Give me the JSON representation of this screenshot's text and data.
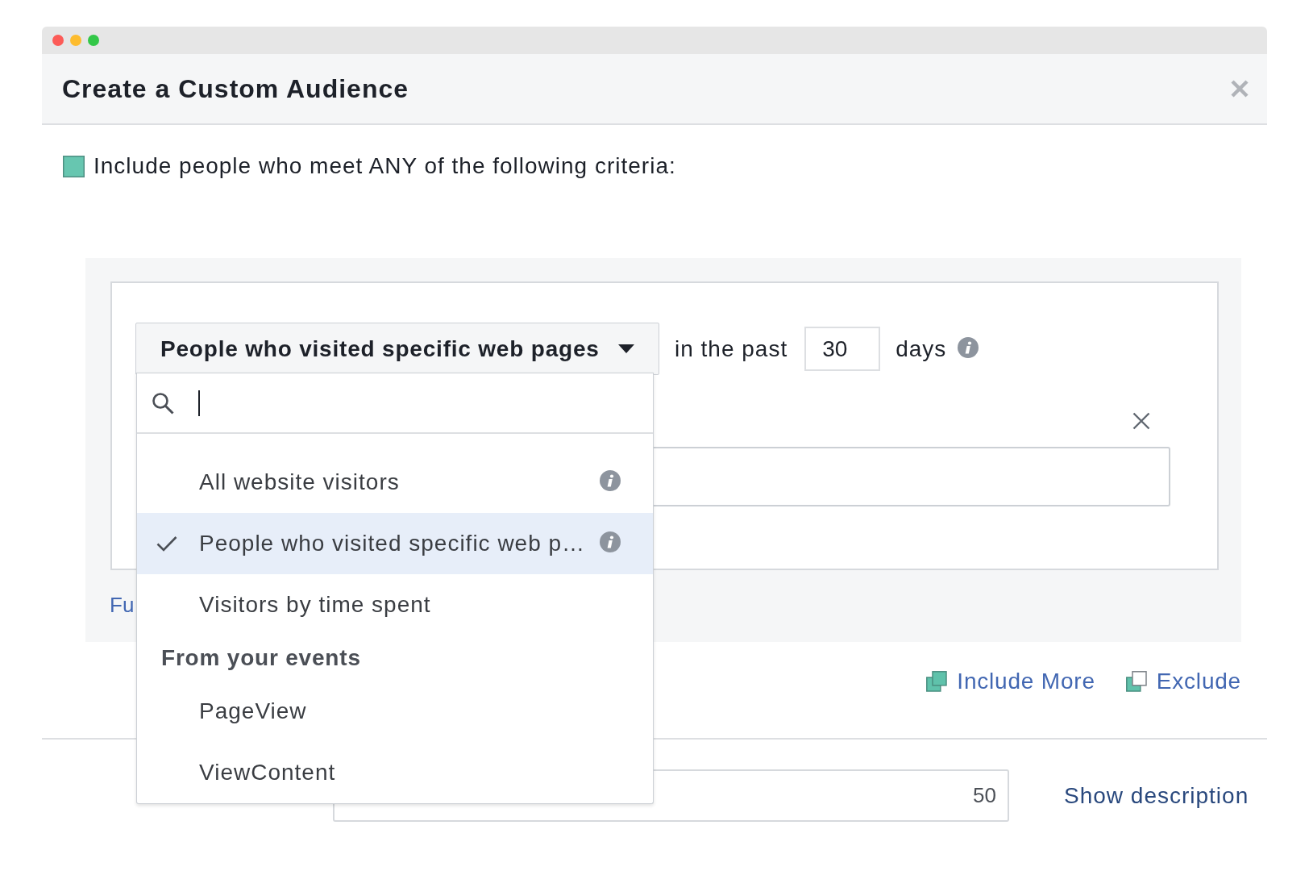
{
  "window": {
    "buttons": [
      {
        "color": "#fc5b57"
      },
      {
        "color": "#fdbc2e"
      },
      {
        "color": "#33c748"
      }
    ]
  },
  "dialog": {
    "title": "Create a Custom Audience"
  },
  "criteria": {
    "text": "Include people who meet ANY of the following criteria:"
  },
  "rule": {
    "source": "People who visited specific web pages",
    "prefix": "in the past",
    "days": "30",
    "suffix": "days",
    "link": "Fu"
  },
  "dropdown": {
    "search": {
      "focused": true
    },
    "options": [
      {
        "label": "All website visitors",
        "selected": false,
        "info": true
      },
      {
        "label": "People who visited specific web p…",
        "selected": true,
        "info": true
      },
      {
        "label": "Visitors by time spent",
        "selected": false,
        "info": false
      }
    ],
    "groups": [
      {
        "heading": "From your events",
        "options": [
          {
            "label": "PageView",
            "selected": false,
            "info": false
          },
          {
            "label": "ViewContent",
            "selected": false,
            "info": false
          }
        ]
      }
    ]
  },
  "actions": [
    {
      "kind": "include",
      "label": "Include More"
    },
    {
      "kind": "exclude",
      "label": "Exclude"
    }
  ],
  "footer": {
    "count": "50",
    "link": "Show description"
  }
}
